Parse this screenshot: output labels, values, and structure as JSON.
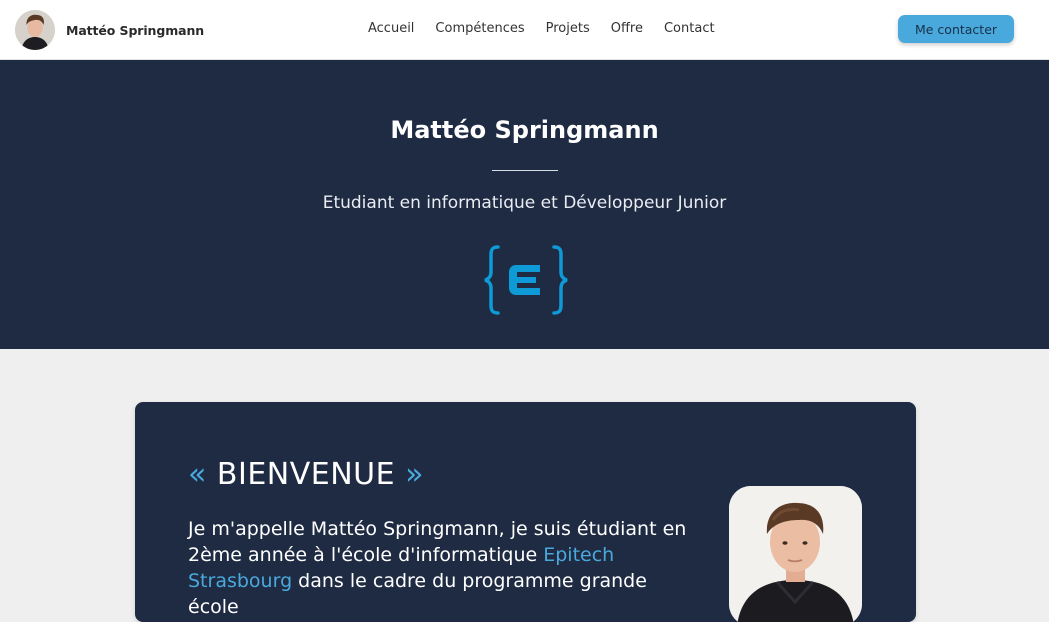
{
  "header": {
    "name": "Mattéo Springmann",
    "nav": [
      "Accueil",
      "Compétences",
      "Projets",
      "Offre",
      "Contact"
    ],
    "cta": "Me contacter"
  },
  "hero": {
    "title": "Mattéo Springmann",
    "subtitle": "Etudiant en informatique et Développeur Junior",
    "logo_letter": "E",
    "logo_icon": "epitech-logo-icon"
  },
  "welcome": {
    "quote_open": "«",
    "heading": "BIENVENUE",
    "quote_close": "»",
    "text_before": "Je m'appelle Mattéo Springmann, je suis étudiant en 2ème année à l'école d'informatique ",
    "link_text": "Epitech Strasbourg",
    "text_after": " dans le cadre du programme grande école"
  },
  "colors": {
    "navy": "#1f2b43",
    "accent": "#4aa9dc",
    "background": "#efefef"
  }
}
